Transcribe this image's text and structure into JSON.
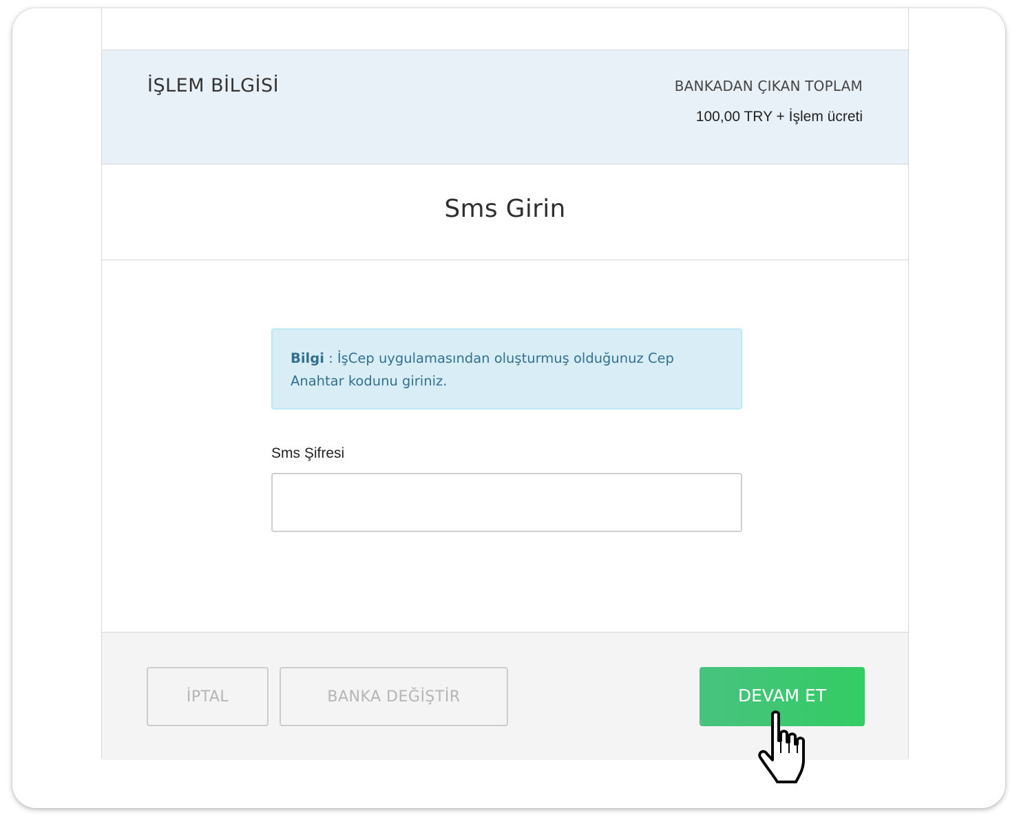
{
  "header": {
    "title": "İŞLEM BİLGİSİ",
    "total_label": "BANKADAN ÇIKAN TOPLAM",
    "total_value": "100,00 TRY + İşlem ücreti"
  },
  "page": {
    "title": "Sms Girin"
  },
  "alert": {
    "label": "Bilgi",
    "separator": " : ",
    "message": "İşCep uygulamasından oluşturmuş olduğunuz Cep Anahtar kodunu giriniz."
  },
  "form": {
    "sms_label": "Sms Şifresi",
    "sms_value": "",
    "sms_placeholder": ""
  },
  "footer": {
    "cancel_label": "İPTAL",
    "change_bank_label": "BANKA DEĞİŞTİR",
    "continue_label": "DEVAM ET"
  },
  "colors": {
    "header_bg": "#e8f0f8",
    "alert_bg": "#d9edf7",
    "alert_text": "#31708f",
    "continue_button": "#33cc63"
  },
  "icons": {
    "cursor": "hand-pointer-icon"
  }
}
